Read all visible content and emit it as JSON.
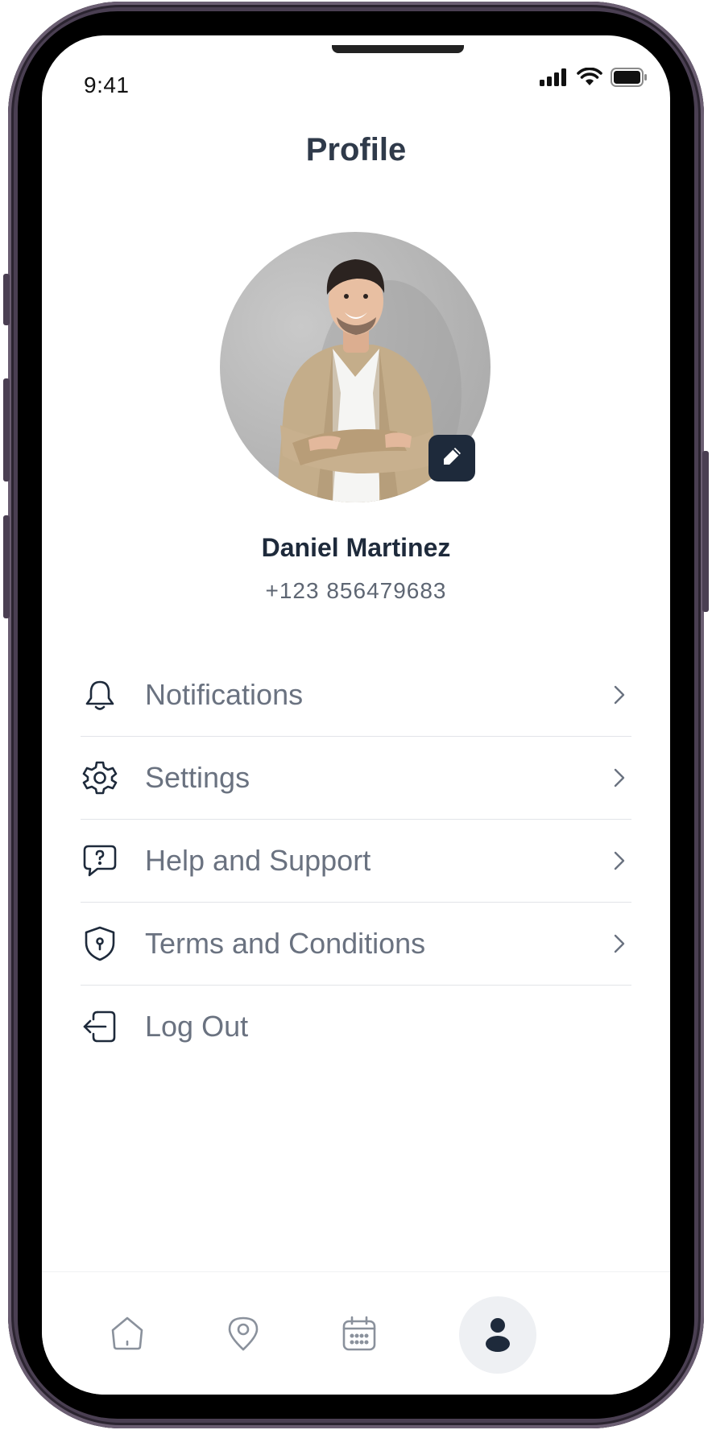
{
  "status_bar": {
    "time": "9:41"
  },
  "header": {
    "title": "Profile"
  },
  "profile": {
    "name": "Daniel Martinez",
    "phone": "+123 856479683"
  },
  "menu": {
    "items": [
      {
        "label": "Notifications",
        "icon": "bell-icon"
      },
      {
        "label": "Settings",
        "icon": "gear-icon"
      },
      {
        "label": "Help and Support",
        "icon": "help-chat-icon"
      },
      {
        "label": "Terms and Conditions",
        "icon": "shield-icon"
      },
      {
        "label": "Log Out",
        "icon": "logout-icon"
      }
    ]
  },
  "bottom_nav": {
    "items": [
      {
        "icon": "home-icon",
        "active": false
      },
      {
        "icon": "location-pin-icon",
        "active": false
      },
      {
        "icon": "calendar-icon",
        "active": false
      },
      {
        "icon": "user-icon",
        "active": true
      }
    ]
  },
  "colors": {
    "primary_dark": "#1e2a3b",
    "text_gray": "#6a7280",
    "divider": "#e2e4e8",
    "active_nav_bg": "#eef0f3"
  }
}
